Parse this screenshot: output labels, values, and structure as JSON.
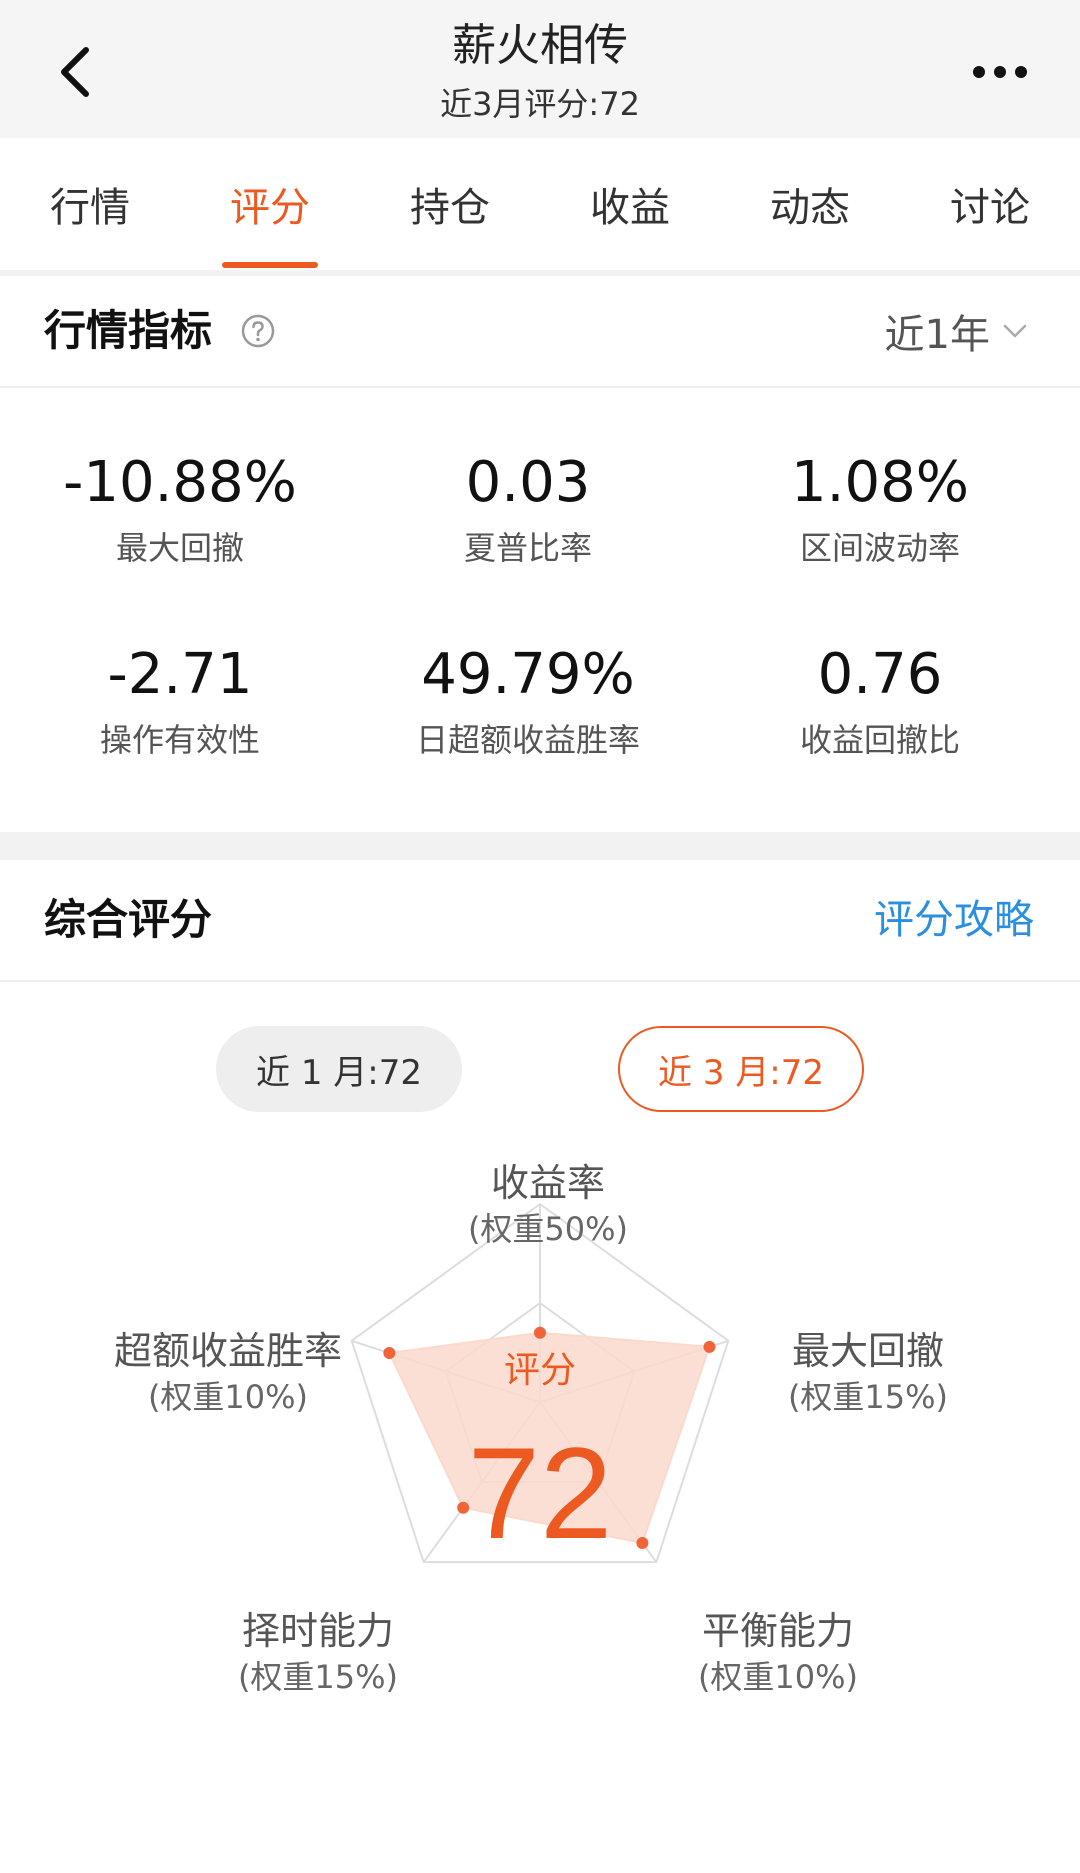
{
  "header": {
    "title": "薪火相传",
    "subtitle": "近3月评分:72"
  },
  "tabs": [
    {
      "label": "行情",
      "active": false
    },
    {
      "label": "评分",
      "active": true
    },
    {
      "label": "持仓",
      "active": false
    },
    {
      "label": "收益",
      "active": false
    },
    {
      "label": "动态",
      "active": false
    },
    {
      "label": "讨论",
      "active": false
    }
  ],
  "market_indicators": {
    "title": "行情指标",
    "period": "近1年",
    "metrics": [
      {
        "value": "-10.88%",
        "label": "最大回撤"
      },
      {
        "value": "0.03",
        "label": "夏普比率"
      },
      {
        "value": "1.08%",
        "label": "区间波动率"
      },
      {
        "value": "-2.71",
        "label": "操作有效性"
      },
      {
        "value": "49.79%",
        "label": "日超额收益胜率"
      },
      {
        "value": "0.76",
        "label": "收益回撤比"
      }
    ]
  },
  "composite_score": {
    "title": "综合评分",
    "guide_link": "评分攻略",
    "periods": [
      {
        "label": "近 1 月:72",
        "active": false
      },
      {
        "label": "近 3 月:72",
        "active": true
      }
    ],
    "center_label": "评分",
    "center_score": "72",
    "axes": [
      {
        "name": "收益率",
        "weight": "(权重50%)",
        "value": 0.35
      },
      {
        "name": "最大回撤",
        "weight": "(权重15%)",
        "value": 0.9
      },
      {
        "name": "平衡能力",
        "weight": "(权重10%)",
        "value": 0.88
      },
      {
        "name": "择时能力",
        "weight": "(权重15%)",
        "value": 0.66
      },
      {
        "name": "超额收益胜率",
        "weight": "(权重10%)",
        "value": 0.8
      }
    ]
  },
  "colors": {
    "accent": "#ec5a21",
    "link": "#2a8fe0",
    "radar_fill": "#fbd9cc",
    "radar_point": "#f0643a"
  }
}
